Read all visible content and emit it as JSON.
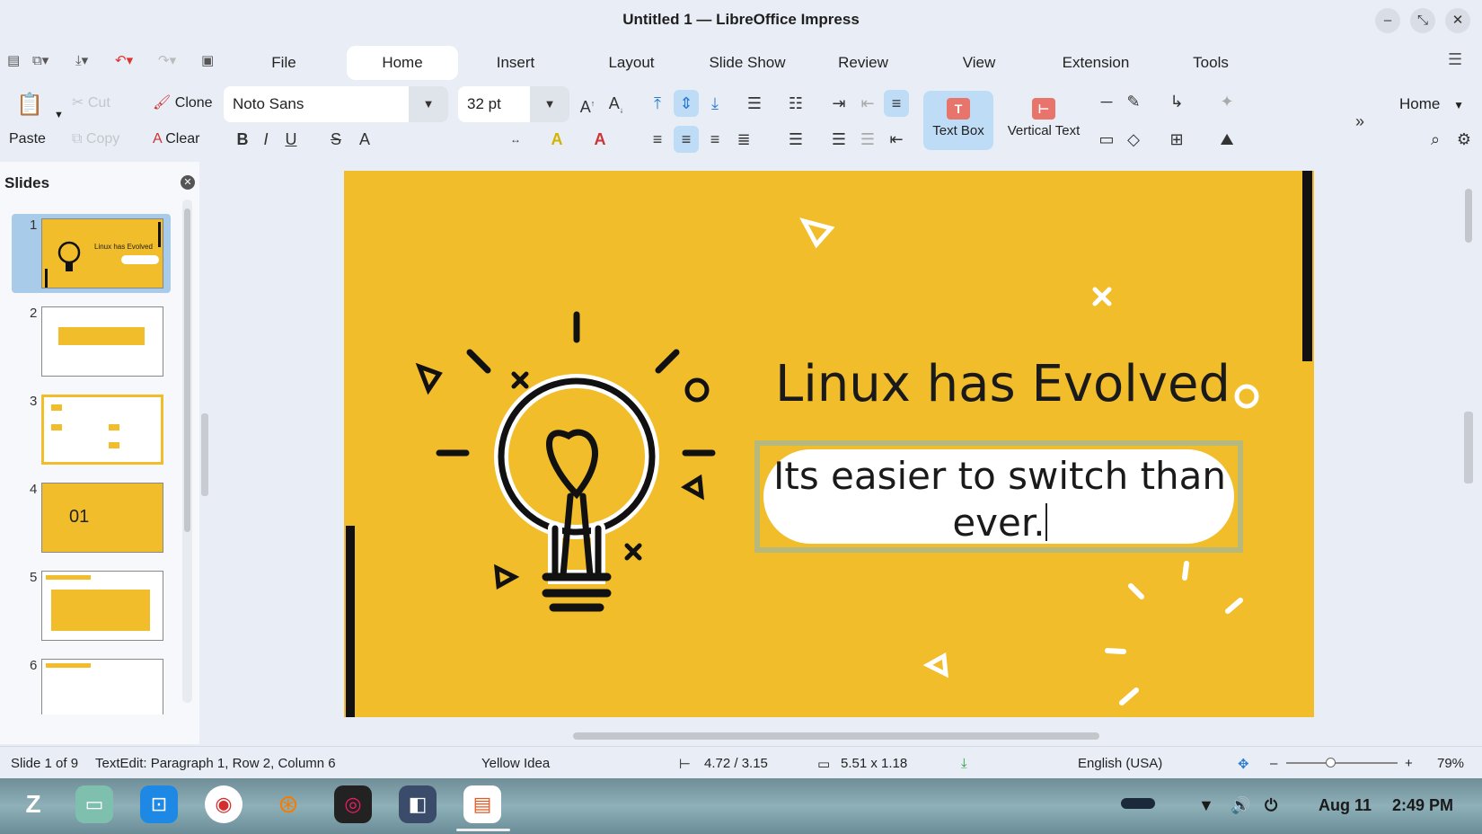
{
  "window": {
    "title": "Untitled 1 — LibreOffice Impress"
  },
  "menu": {
    "tabs": [
      "File",
      "Home",
      "Insert",
      "Layout",
      "Slide Show",
      "Review",
      "View",
      "Extension",
      "Tools"
    ],
    "active": "Home"
  },
  "toolbar": {
    "paste": "Paste",
    "cut": "Cut",
    "copy": "Copy",
    "clone": "Clone",
    "clear": "Clear",
    "font_name": "Noto Sans",
    "font_size": "32 pt",
    "text_box": "Text Box",
    "vertical_text": "Vertical Text",
    "home_dropdown": "Home"
  },
  "slides_pane": {
    "header": "Slides",
    "numbers": [
      "1",
      "2",
      "3",
      "4",
      "5",
      "6"
    ],
    "thumb1_title": "Linux has Evolved",
    "thumb4_text": "01"
  },
  "slide": {
    "title": "Linux has Evolved",
    "subtitle_line1": "Its easier to switch than",
    "subtitle_line2": "ever.",
    "background_color": "#f1bd2b"
  },
  "status": {
    "slide": "Slide 1 of 9",
    "edit": "TextEdit: Paragraph 1, Row 2, Column 6",
    "theme": "Yellow Idea",
    "position": "4.72 / 3.15",
    "size": "5.51 x 1.18",
    "language": "English (USA)",
    "zoom": "79%"
  },
  "taskbar": {
    "date": "Aug 11",
    "time": "2:49 PM"
  }
}
